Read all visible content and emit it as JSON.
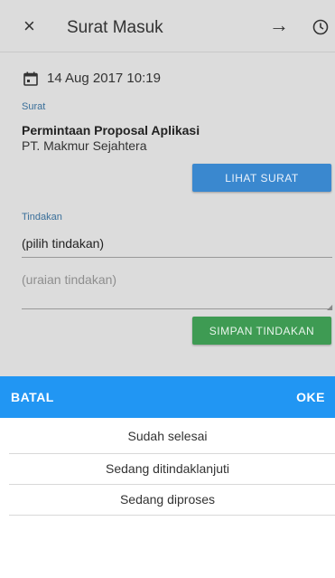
{
  "appbar": {
    "title": "Surat Masuk",
    "close_icon": "×",
    "forward_icon": "→"
  },
  "detail": {
    "date": "14 Aug 2017 10:19",
    "surat_label": "Surat",
    "surat_subject": "Permintaan Proposal Aplikasi",
    "surat_sender": "PT. Makmur Sejahtera",
    "view_button": "LIHAT SURAT",
    "tindakan_label": "Tindakan",
    "tindakan_select": "(pilih tindakan)",
    "uraian_placeholder": "(uraian tindakan)",
    "save_button": "SIMPAN TINDAKAN"
  },
  "picker": {
    "cancel_label": "BATAL",
    "ok_label": "OKE",
    "options": [
      "Sudah selesai",
      "Sedang ditindaklanjuti",
      "Sedang diproses"
    ]
  },
  "colors": {
    "picker_bar": "#2196f3",
    "view_button": "#3a88cf",
    "save_button": "#3e9b53",
    "overlay": "#dcdcdc"
  }
}
